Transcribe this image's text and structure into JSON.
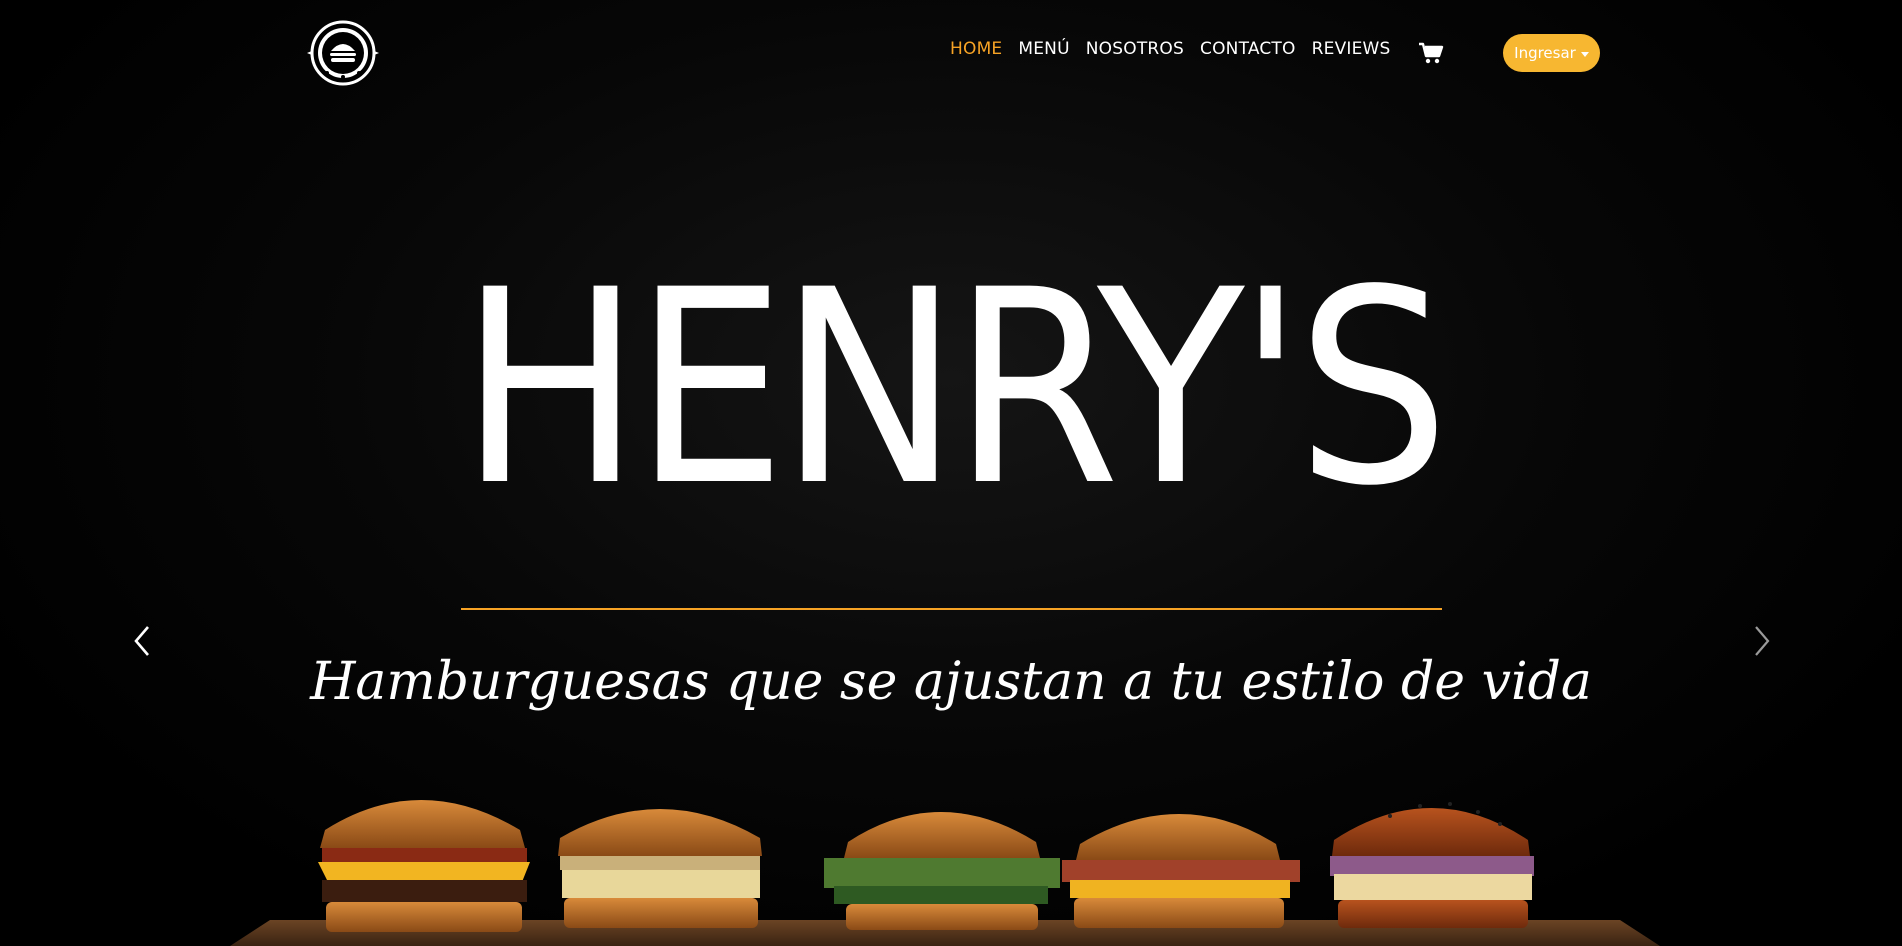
{
  "brand": {
    "logo_text": "HENRY'S",
    "title": "HENRY'S",
    "tagline": "Hamburguesas que se ajustan a tu estilo de vida"
  },
  "nav": {
    "items": [
      {
        "label": "HOME",
        "active": true
      },
      {
        "label": "MENÚ",
        "active": false
      },
      {
        "label": "NOSOTROS",
        "active": false
      },
      {
        "label": "CONTACTO",
        "active": false
      },
      {
        "label": "REVIEWS",
        "active": false
      }
    ],
    "cart_icon": "shopping-cart-icon",
    "login_label": "Ingresar"
  },
  "carousel": {
    "prev_icon": "chevron-left-icon",
    "next_icon": "chevron-right-icon"
  },
  "colors": {
    "accent": "#f7a325",
    "button": "#f7b731",
    "background": "#000000",
    "text": "#ffffff"
  }
}
